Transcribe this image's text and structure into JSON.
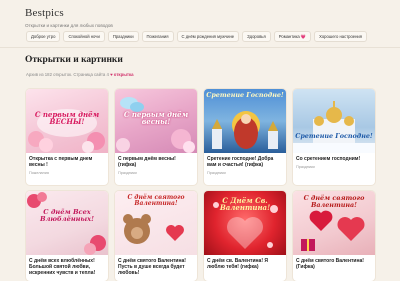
{
  "site": {
    "logo": "Bestpics",
    "tagline": "Открытки и картинки для любых поводов"
  },
  "nav": [
    {
      "label": "Доброе утро"
    },
    {
      "label": "Спокойной ночи"
    },
    {
      "label": "Праздники"
    },
    {
      "label": "Пожелания"
    },
    {
      "label": "С днём рождения мужчине"
    },
    {
      "label": "Здоровья"
    },
    {
      "label": "Романтика",
      "emoji": "💗"
    },
    {
      "label": "Хорошего настроения"
    }
  ],
  "main": {
    "title": "Открытки и картинки",
    "archive_note": "Архив из 182 открыток. Страница сайта 4",
    "archive_flag": "♥ открытка"
  },
  "cards": [
    {
      "title": "Открытка с первым днем весны !",
      "meta": "Пожелания",
      "thumb_text": "С первым днём ВЕСНЫ!",
      "bg": "#f4c6d6"
    },
    {
      "title": "С первым днём весны! (гифка)",
      "meta": "Праздники",
      "thumb_text": "С первым днём весны!",
      "bg": "#e8a6c8"
    },
    {
      "title": "Сретение господне! Добра вам и счастья! (гифка)",
      "meta": "Праздники",
      "thumb_text": "Сретение Господне!",
      "bg": "#7fb4e0"
    },
    {
      "title": "Со сретением господним!",
      "meta": "Праздники",
      "thumb_text": "Сретение Господне!",
      "bg": "#a8c8e4"
    },
    {
      "title": "С днём всех влюблённых! Большой святой любви, искренних чувств и тепла!",
      "meta": "Праздники",
      "thumb_text": "С днём Всех Влюблённых!",
      "bg": "#f3d9e0"
    },
    {
      "title": "С днём святого Валентина! Пусть в душе всегда будет любовь!",
      "meta": "Праздники",
      "thumb_text": "С днём святого Валентина!",
      "bg": "#f6dfe4"
    },
    {
      "title": "С днём св. Валентина! Я люблю тебя! (гифка)",
      "meta": "Праздники",
      "thumb_text": "С Днём Св. Валентина!",
      "bg": "#e0242e"
    },
    {
      "title": "С днём святого Валентина! (Гифка)",
      "meta": "Праздники",
      "thumb_text": "С днём святого Валентина!",
      "bg": "#f2c9cf"
    }
  ]
}
